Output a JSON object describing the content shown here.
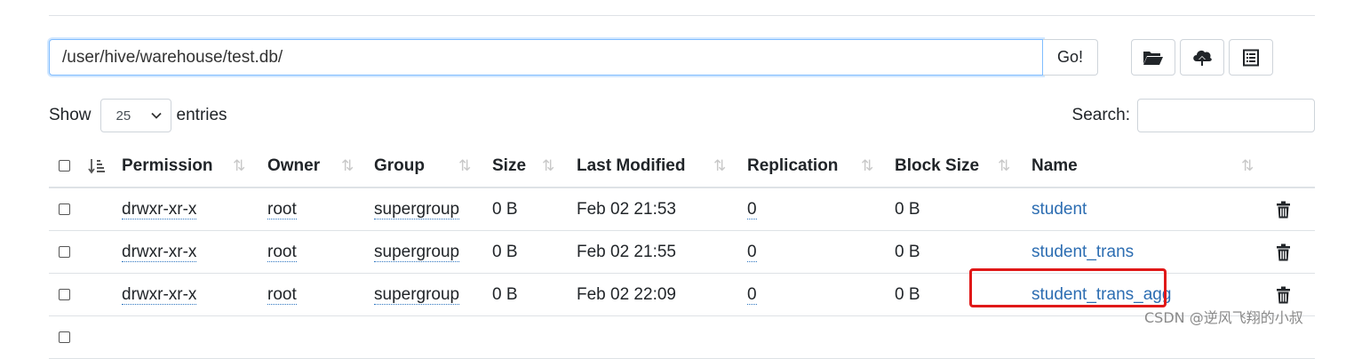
{
  "path_bar": {
    "path_value": "/user/hive/warehouse/test.db/",
    "go_label": "Go!"
  },
  "toolbar": {
    "icons": [
      "folder-open-icon",
      "cloud-upload-icon",
      "list-icon"
    ]
  },
  "entries": {
    "show_label": "Show",
    "selected": "25",
    "entries_label": "entries"
  },
  "search": {
    "label": "Search:",
    "value": ""
  },
  "table": {
    "headers": {
      "permission": "Permission",
      "owner": "Owner",
      "group": "Group",
      "size": "Size",
      "last_modified": "Last Modified",
      "replication": "Replication",
      "block_size": "Block Size",
      "name": "Name"
    },
    "rows": [
      {
        "permission": "drwxr-xr-x",
        "owner": "root",
        "group": "supergroup",
        "size": "0 B",
        "last_modified": "Feb 02 21:53",
        "replication": "0",
        "block_size": "0 B",
        "name": "student"
      },
      {
        "permission": "drwxr-xr-x",
        "owner": "root",
        "group": "supergroup",
        "size": "0 B",
        "last_modified": "Feb 02 21:55",
        "replication": "0",
        "block_size": "0 B",
        "name": "student_trans"
      },
      {
        "permission": "drwxr-xr-x",
        "owner": "root",
        "group": "supergroup",
        "size": "0 B",
        "last_modified": "Feb 02 22:09",
        "replication": "0",
        "block_size": "0 B",
        "name": "student_trans_agg"
      }
    ]
  },
  "colors": {
    "accent_link": "#2c6db2",
    "highlight": "#e01818",
    "focus_border": "#80bdff"
  },
  "watermark": "CSDN @逆风飞翔的小叔"
}
